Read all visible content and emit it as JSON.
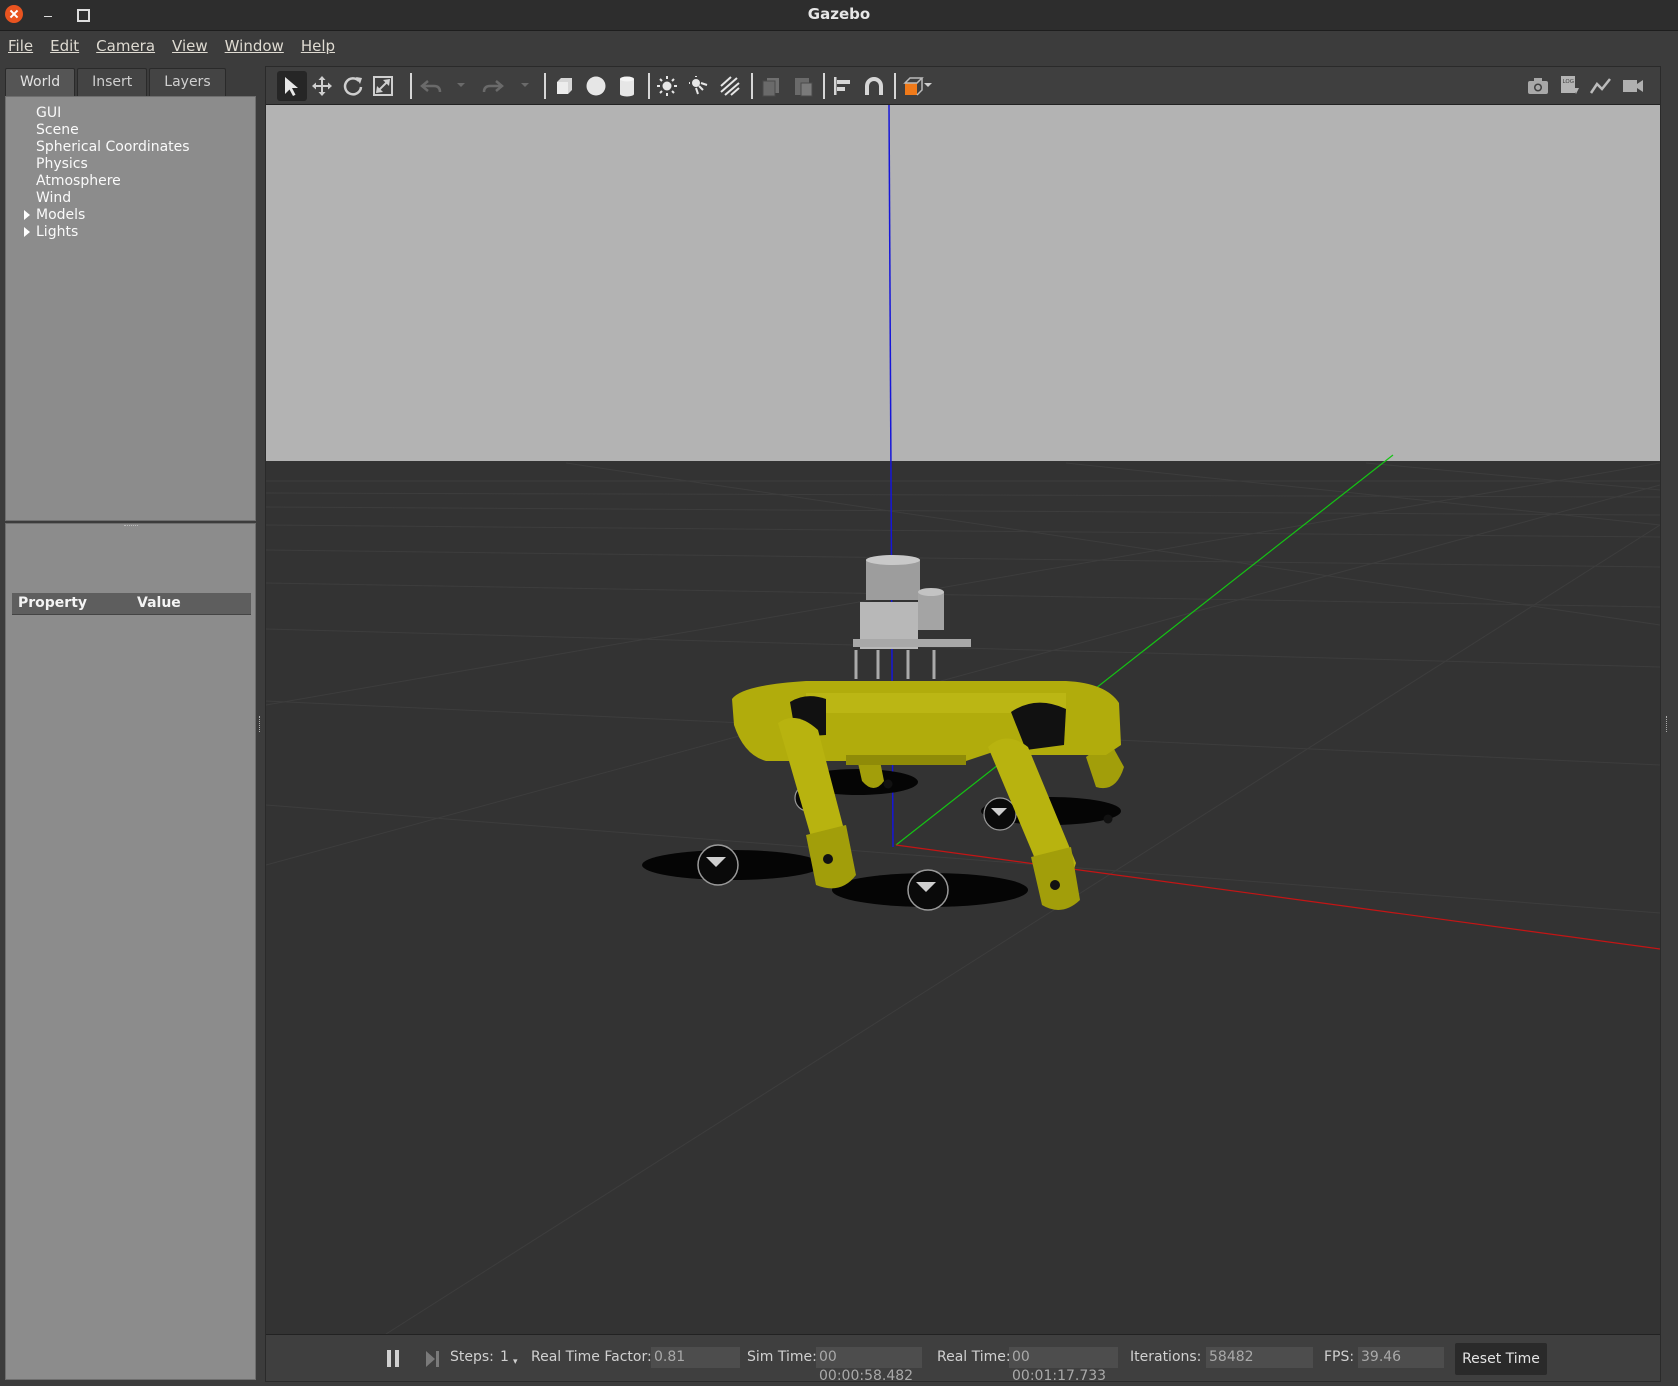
{
  "window": {
    "title": "Gazebo"
  },
  "menu": [
    "File",
    "Edit",
    "Camera",
    "View",
    "Window",
    "Help"
  ],
  "left_tabs": [
    "World",
    "Insert",
    "Layers"
  ],
  "world_tree": [
    "GUI",
    "Scene",
    "Spherical Coordinates",
    "Physics",
    "Atmosphere",
    "Wind",
    "Models",
    "Lights"
  ],
  "props": {
    "property": "Property",
    "value": "Value"
  },
  "bottom": {
    "steps_label": "Steps:",
    "steps_value": "1",
    "rtf_label": "Real Time Factor:",
    "rtf_value": "0.81",
    "sim_time_label": "Sim Time:",
    "sim_time_value": "00 00:00:58.482",
    "real_time_label": "Real Time:",
    "real_time_value": "00 00:01:17.733",
    "iterations_label": "Iterations:",
    "iterations_value": "58482",
    "fps_label": "FPS:",
    "fps_value": "39.46",
    "reset_label": "Reset Time"
  },
  "toolbar_icons": [
    "select-mode-icon",
    "translate-mode-icon",
    "rotate-mode-icon",
    "scale-mode-icon",
    "undo-icon",
    "redo-icon",
    "box-shape-icon",
    "sphere-shape-icon",
    "cylinder-shape-icon",
    "point-light-icon",
    "spot-light-icon",
    "directional-light-icon",
    "copy-icon",
    "paste-icon",
    "align-icon",
    "snap-icon",
    "view-angle-icon",
    "screenshot-icon",
    "log-icon",
    "plot-icon",
    "video-record-icon"
  ],
  "colors": {
    "accent": "#e95420",
    "robot_yellow": "#b1ac0c",
    "sky": "#b3b3b3",
    "ground": "#343434",
    "axis_x": "#c41515",
    "axis_y": "#14c414",
    "axis_z": "#1616d8"
  }
}
